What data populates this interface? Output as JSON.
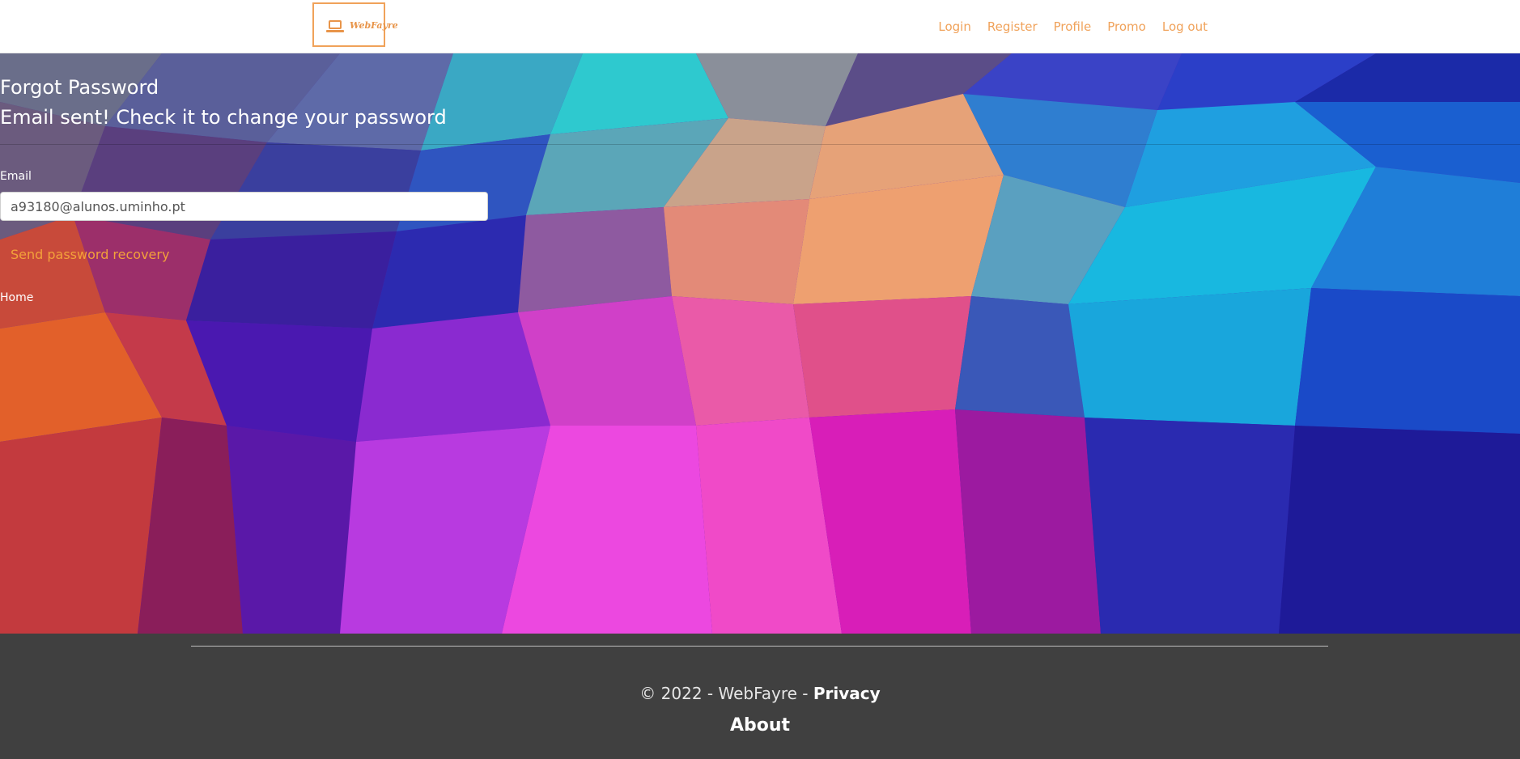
{
  "brand": {
    "logo_text": "WebFayre",
    "accent": "#f0a25a"
  },
  "nav": {
    "items": [
      {
        "label": "Login"
      },
      {
        "label": "Register"
      },
      {
        "label": "Profile"
      },
      {
        "label": "Promo"
      },
      {
        "label": "Log out"
      }
    ]
  },
  "main": {
    "title": "Forgot Password",
    "status_message": "Email sent! Check it to change your password",
    "email_label": "Email",
    "email_value": "a93180@alunos.uminho.pt",
    "send_button_label": "Send password recovery",
    "home_link": "Home"
  },
  "footer": {
    "copyright_prefix": "© 2022 - WebFayre - ",
    "privacy_label": "Privacy",
    "about_label": "About",
    "background": "#404040"
  }
}
